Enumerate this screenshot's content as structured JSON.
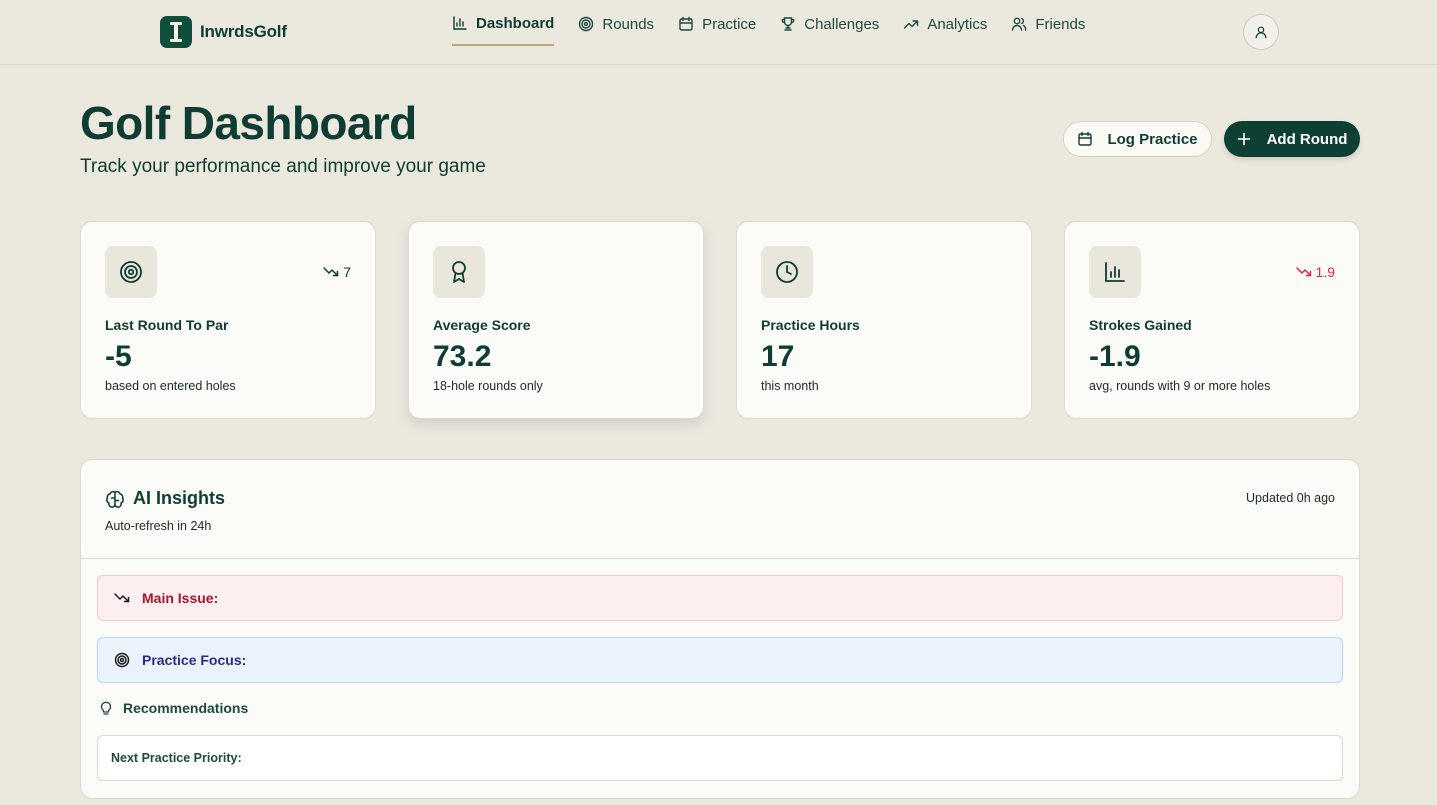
{
  "app": {
    "name": "InwrdsGolf"
  },
  "nav": {
    "items": [
      {
        "label": "Dashboard",
        "icon": "bar-chart-icon",
        "active": true
      },
      {
        "label": "Rounds",
        "icon": "target-icon"
      },
      {
        "label": "Practice",
        "icon": "calendar-icon"
      },
      {
        "label": "Challenges",
        "icon": "trophy-icon"
      },
      {
        "label": "Analytics",
        "icon": "trending-up-icon"
      },
      {
        "label": "Friends",
        "icon": "users-icon"
      }
    ]
  },
  "header": {
    "title": "Golf Dashboard",
    "subtitle": "Track your performance and improve your game",
    "log_practice_label": "Log Practice",
    "add_round_label": "Add Round"
  },
  "stats": [
    {
      "label": "Last Round To Par",
      "value": "-5",
      "note": "based on entered holes",
      "trend": "7",
      "trend_color": "#0f3d33",
      "icon": "target-icon"
    },
    {
      "label": "Average Score",
      "value": "73.2",
      "note": "18-hole rounds only",
      "icon": "award-icon"
    },
    {
      "label": "Practice Hours",
      "value": "17",
      "note": "this month",
      "icon": "clock-icon"
    },
    {
      "label": "Strokes Gained",
      "value": "-1.9",
      "note": "avg, rounds with 9 or more holes",
      "trend": "1.9",
      "trend_color": "#e0284a",
      "icon": "bar-chart-icon"
    }
  ],
  "insights": {
    "title": "AI Insights",
    "subtitle": "Auto-refresh in 24h",
    "updated": "Updated 0h ago",
    "main_issue_label": "Main Issue:",
    "practice_focus_label": "Practice Focus:",
    "recommendations_title": "Recommendations",
    "next_priority_label": "Next Practice Priority:"
  },
  "colors": {
    "background": "#ebe8de",
    "primary": "#0d3f33",
    "negative": "#e0284a",
    "issue_bg": "#fdeff0",
    "focus_bg": "#eaf3fc"
  }
}
